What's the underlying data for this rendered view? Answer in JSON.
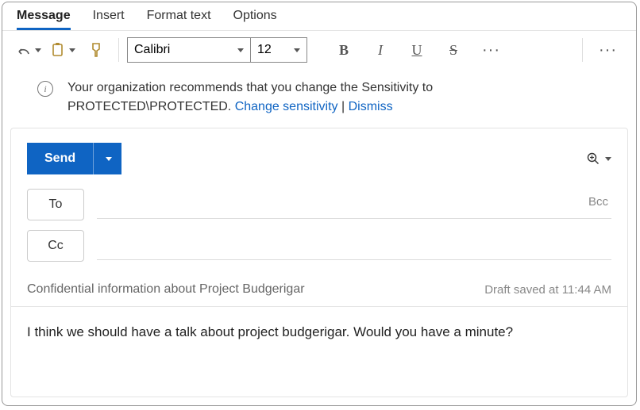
{
  "tabs": {
    "message": "Message",
    "insert": "Insert",
    "format_text": "Format text",
    "options": "Options"
  },
  "font": {
    "name": "Calibri",
    "size": "12"
  },
  "info": {
    "text1": "Your organization recommends that you change the Sensitivity to",
    "text2": "PROTECTED\\PROTECTED. ",
    "change": "Change sensitivity",
    "sep": " | ",
    "dismiss": "Dismiss"
  },
  "compose": {
    "send": "Send",
    "to_label": "To",
    "cc_label": "Cc",
    "bcc_label": "Bcc",
    "subject": "Confidential information about Project Budgerigar",
    "draft_status": "Draft saved at 11:44 AM",
    "body": "I think we should have a talk about project budgerigar. Would you have a minute?"
  }
}
